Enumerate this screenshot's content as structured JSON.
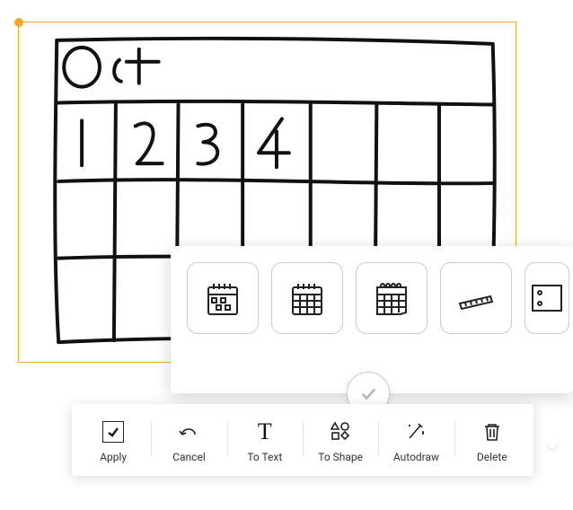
{
  "sketch": {
    "title_text": "Oct",
    "cell_labels": [
      "1",
      "2",
      "3",
      "4"
    ]
  },
  "suggestions": {
    "items": [
      {
        "name": "calendar-dots"
      },
      {
        "name": "calendar-grid"
      },
      {
        "name": "calendar-tear"
      },
      {
        "name": "ruler"
      },
      {
        "name": "abacus"
      }
    ]
  },
  "toolbar": {
    "apply": {
      "label": "Apply"
    },
    "cancel": {
      "label": "Cancel"
    },
    "to_text": {
      "label": "To Text"
    },
    "to_shape": {
      "label": "To Shape"
    },
    "autodraw": {
      "label": "Autodraw"
    },
    "delete": {
      "label": "Delete"
    }
  }
}
